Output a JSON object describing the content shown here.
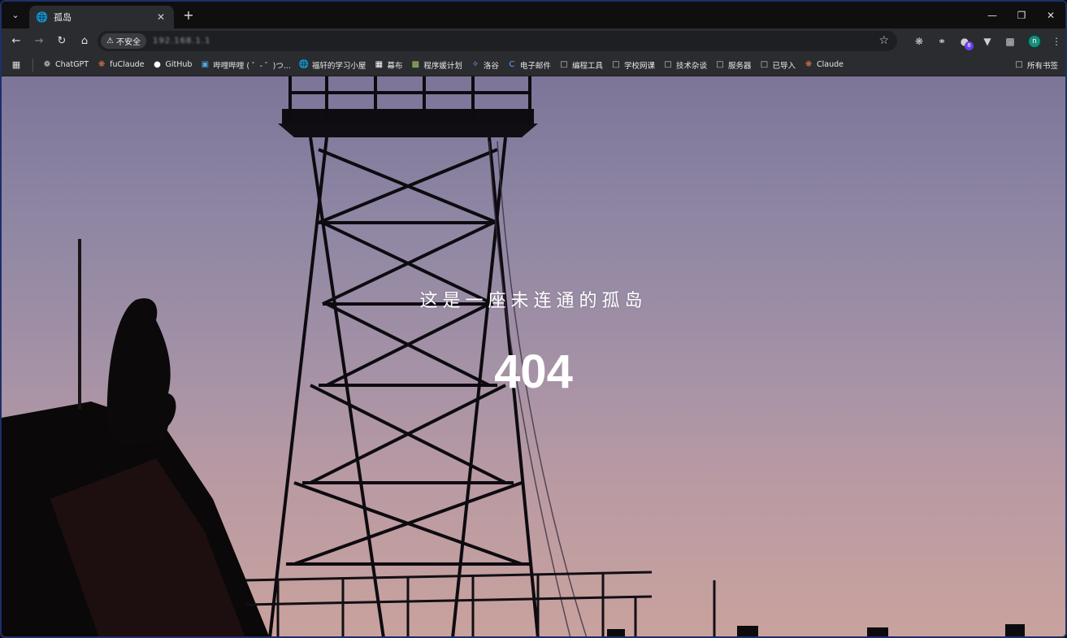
{
  "browser": {
    "tab": {
      "title": "孤岛",
      "favicon": "globe-icon"
    },
    "toolbar": {
      "security_label": "不安全",
      "url": "192.168.1.1"
    },
    "bookmarks": [
      {
        "label": "ChatGPT",
        "icon": "openai-icon"
      },
      {
        "label": "fuClaude",
        "icon": "claude-icon"
      },
      {
        "label": "GitHub",
        "icon": "github-icon"
      },
      {
        "label": "哔哩哔哩 ( ゜- ゜)つ...",
        "icon": "bilibili-icon"
      },
      {
        "label": "福轩的学习小屋",
        "icon": "globe-icon"
      },
      {
        "label": "幕布",
        "icon": "mubu-icon"
      },
      {
        "label": "程序媛计划",
        "icon": "site-icon"
      },
      {
        "label": "洛谷",
        "icon": "luogu-icon"
      },
      {
        "label": "电子邮件",
        "icon": "mail-icon"
      },
      {
        "label": "编程工具",
        "icon": "folder-icon"
      },
      {
        "label": "学校网课",
        "icon": "folder-icon"
      },
      {
        "label": "技术杂谈",
        "icon": "folder-icon"
      },
      {
        "label": "服务器",
        "icon": "folder-icon"
      },
      {
        "label": "已导入",
        "icon": "folder-icon"
      },
      {
        "label": "Claude",
        "icon": "claude-icon"
      }
    ],
    "all_bookmarks": "所有书签",
    "extension_badge": "8",
    "profile_initial": "n"
  },
  "page": {
    "headline": "这是一座未连通的孤岛",
    "code": "404"
  }
}
